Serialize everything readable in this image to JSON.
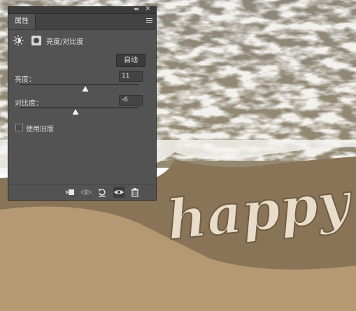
{
  "panel": {
    "tab": "属性",
    "header_title": "亮度/对比度",
    "auto_button": "自动",
    "brightness": {
      "label": "亮度：",
      "value": "11",
      "level_percent": 55
    },
    "contrast": {
      "label": "对比度：",
      "value": "-6",
      "level_percent": 47
    },
    "legacy_checkbox": {
      "label": "使用旧版",
      "checked": false
    }
  },
  "canvas": {
    "sand_text": "happy h"
  },
  "icons": {
    "collapse": "double-chevron-icon",
    "close": "close-icon",
    "menu": "panel-menu-icon",
    "adjustment": "brightness-contrast-icon",
    "mask": "layer-mask-icon",
    "clip": "clip-to-layer-icon",
    "view_prev": "view-previous-state-icon",
    "reset": "reset-icon",
    "visibility": "eye-icon",
    "delete": "trash-icon"
  },
  "colors": {
    "panel_bg": "#535353",
    "sea": "#8c8577",
    "foam": "#ffffff",
    "sand": "#a68a67"
  }
}
